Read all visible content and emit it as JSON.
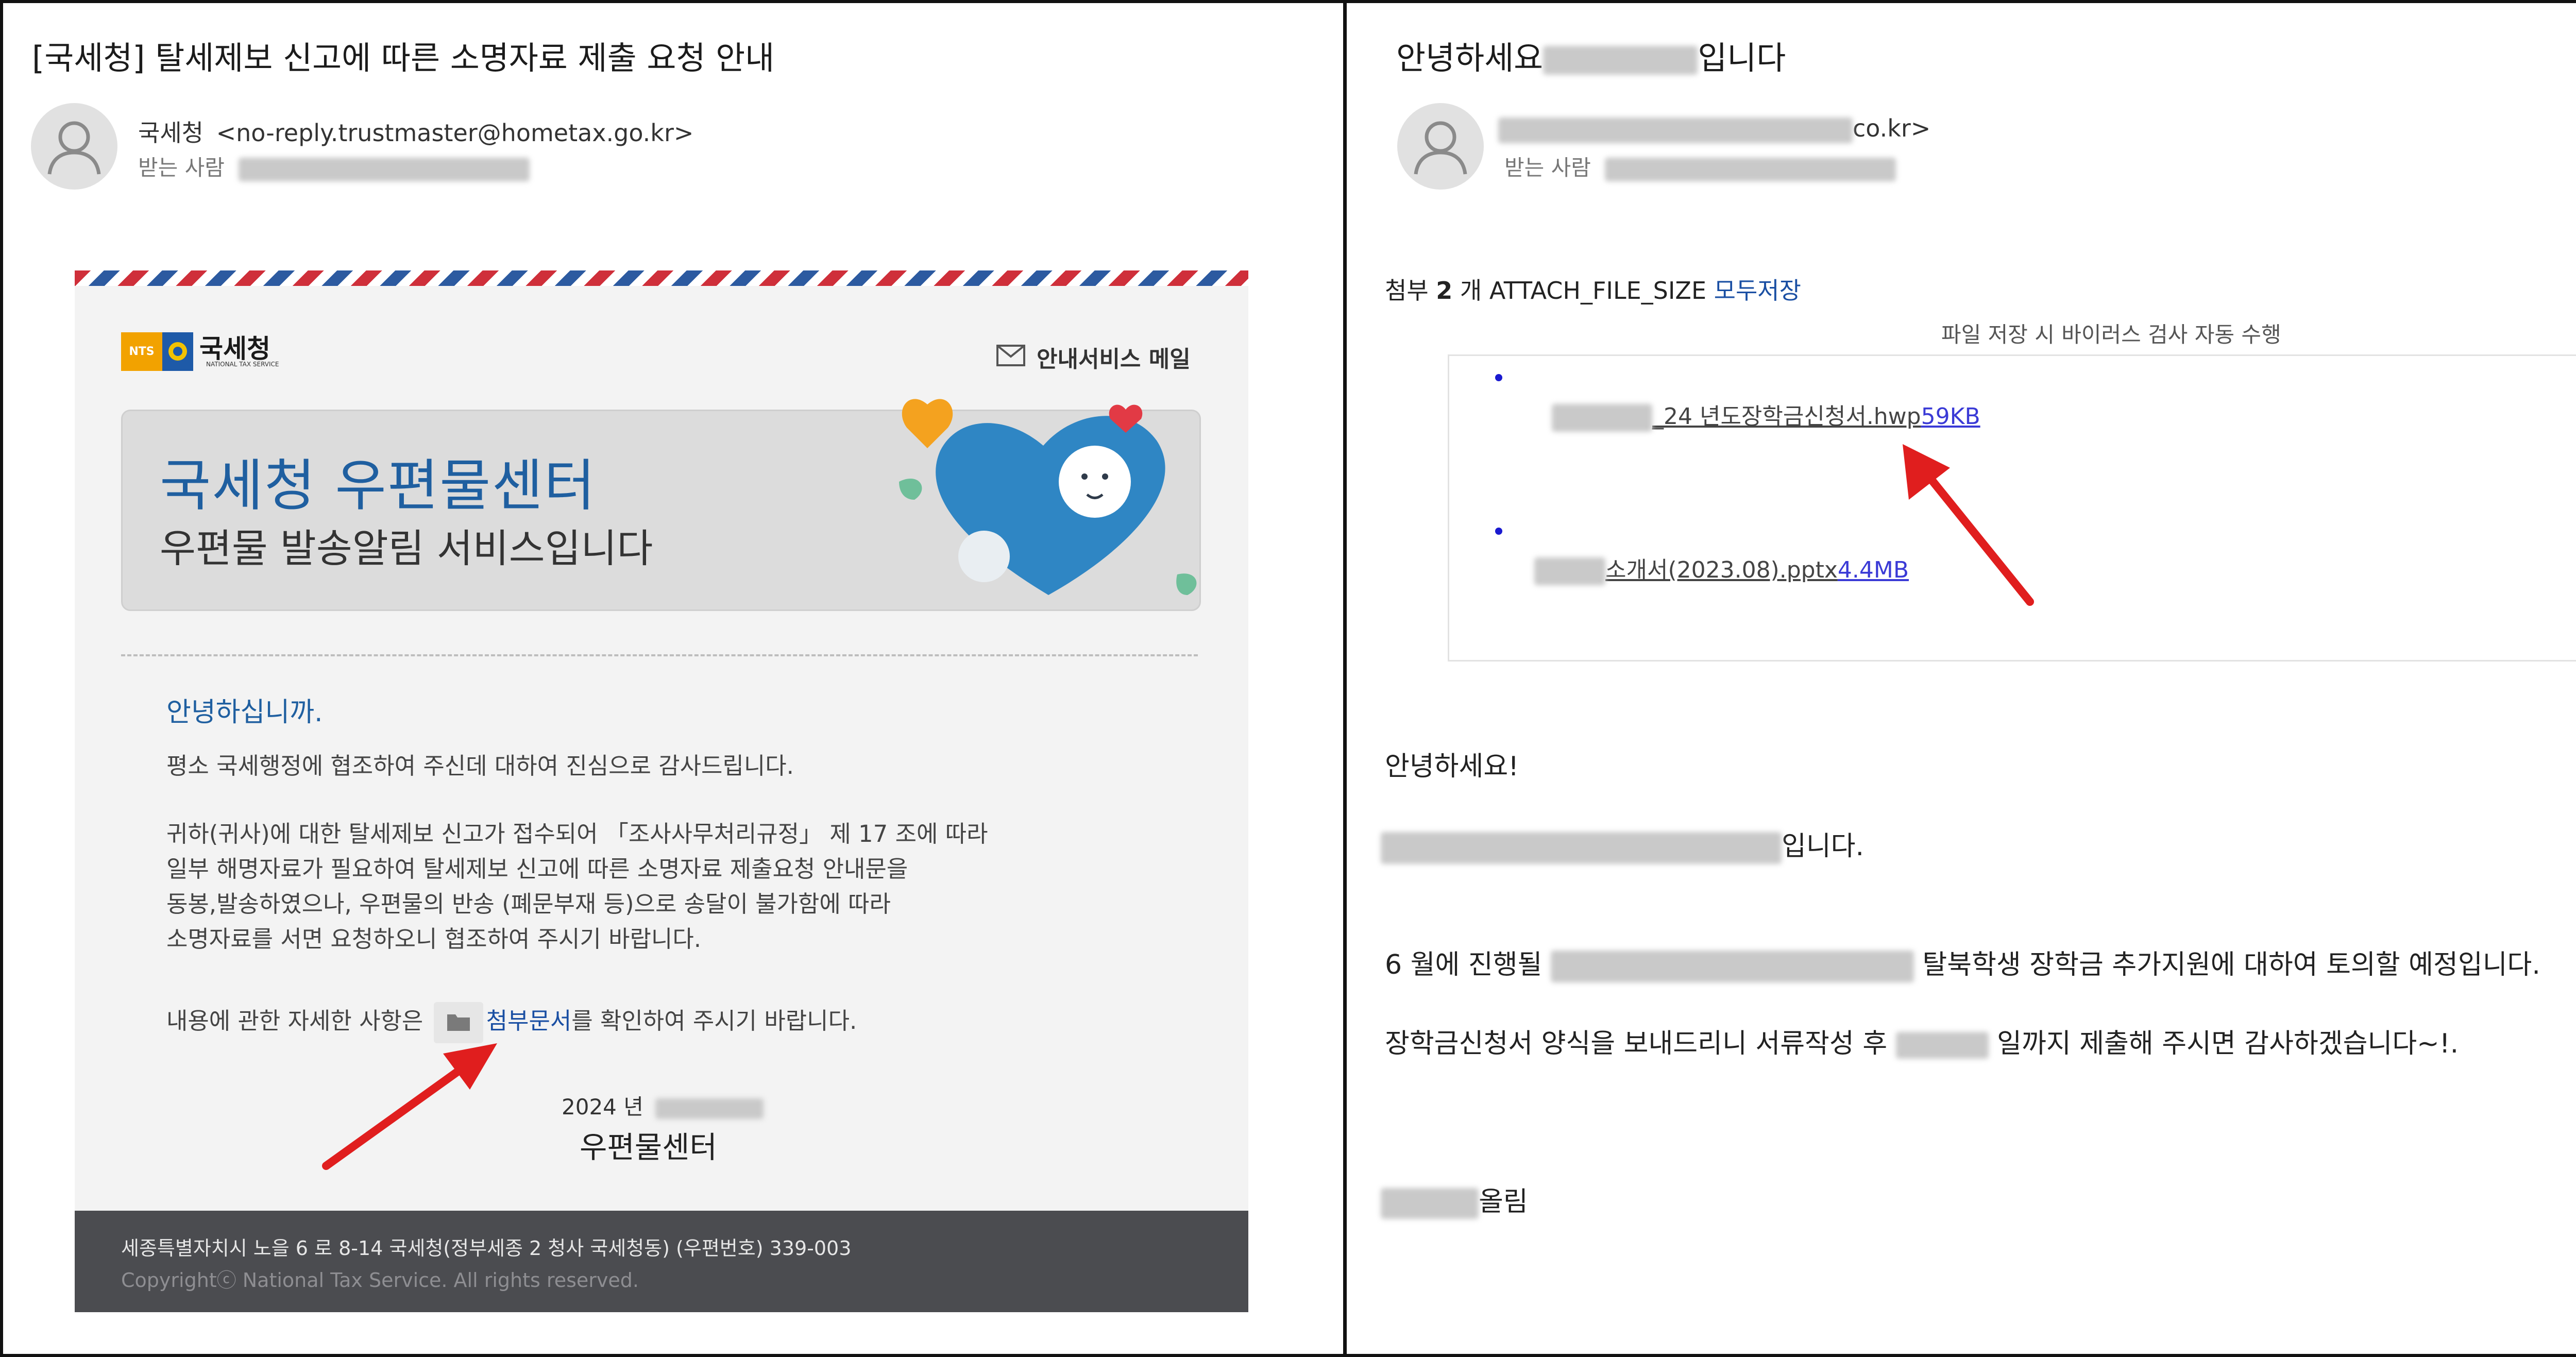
{
  "left_email": {
    "subject": "[국세청] 탈세제보 신고에 따른 소명자료 제출 요청 안내",
    "sender_name": "국세청",
    "sender_email": "<no-reply.trustmaster@hometax.go.kr>",
    "recipient_label": "받는 사람",
    "nts_logo_text": "NTS",
    "nts_name": "국세청",
    "nts_name_en": "NATIONAL TAX SERVICE",
    "guide_mail_label": "안내서비스 메일",
    "banner_title": "국세청 우편물센터",
    "banner_subtitle": "우편물 발송알림 서비스입니다",
    "greeting": "안녕하십니까.",
    "para1": "평소 국세행정에 협조하여 주신데 대하여 진심으로 감사드립니다.",
    "para2_lines": [
      "귀하(귀사)에 대한 탈세제보 신고가 접수되어 「조사사무처리규정」 제 17 조에 따라",
      "일부 해명자료가 필요하여 탈세제보 신고에 따른 소명자료 제출요청 안내문을",
      "동봉,발송하였으나, 우편물의 반송 (폐문부재 등)으로 송달이 불가함에 따라",
      "소명자료를 서면 요청하오니 협조하여 주시기 바랍니다."
    ],
    "para3_prefix": "내용에 관한 자세한 사항은",
    "attachment_link": "첨부문서",
    "para3_suffix": "를 확인하여 주시기 바랍니다.",
    "date_year": "2024 년",
    "center_name": "우편물센터",
    "footer_address": "세종특별자치시 노을 6 로 8-14 국세청(정부세종 2 청사 국세청동) (우편번호) 339-003",
    "footer_copyright": "Copyrightⓒ National Tax Service. All rights reserved."
  },
  "right_email": {
    "subject_prefix": "안녕하세요",
    "subject_suffix": "입니다",
    "sender_suffix": "co.kr>",
    "recipient_label": "받는 사람",
    "attach_label": "첨부",
    "attach_count": "2",
    "attach_unit": "개",
    "attach_size_placeholder": "ATTACH_FILE_SIZE",
    "save_all": "모두저장",
    "virus_scan_note": "파일 저장 시 바이러스 검사 자동 수행",
    "files": [
      {
        "name": "_24 년도장학금신청서.hwp",
        "size": "59KB"
      },
      {
        "name": "소개서(2023.08).pptx",
        "size": "4.4MB"
      }
    ],
    "body_greeting": "안녕하세요!",
    "body_intro_suffix": "입니다.",
    "body_line1_prefix": "6 월에 진행될",
    "body_line1_suffix": "탈북학생 장학금 추가지원에 대하여 토의할 예정입니다.",
    "body_line2_prefix": "장학금신청서 양식을 보내드리니 서류작성 후",
    "body_line2_suffix": "일까지 제출해 주시면 감사하겠습니다~!.",
    "signoff": "올림"
  },
  "colors": {
    "link_blue": "#1a4fa3",
    "size_link": "#3a3ad6",
    "arrow_red": "#e01e1e",
    "banner_title": "#1f5fa0",
    "footer_bg": "#4b4c50"
  }
}
